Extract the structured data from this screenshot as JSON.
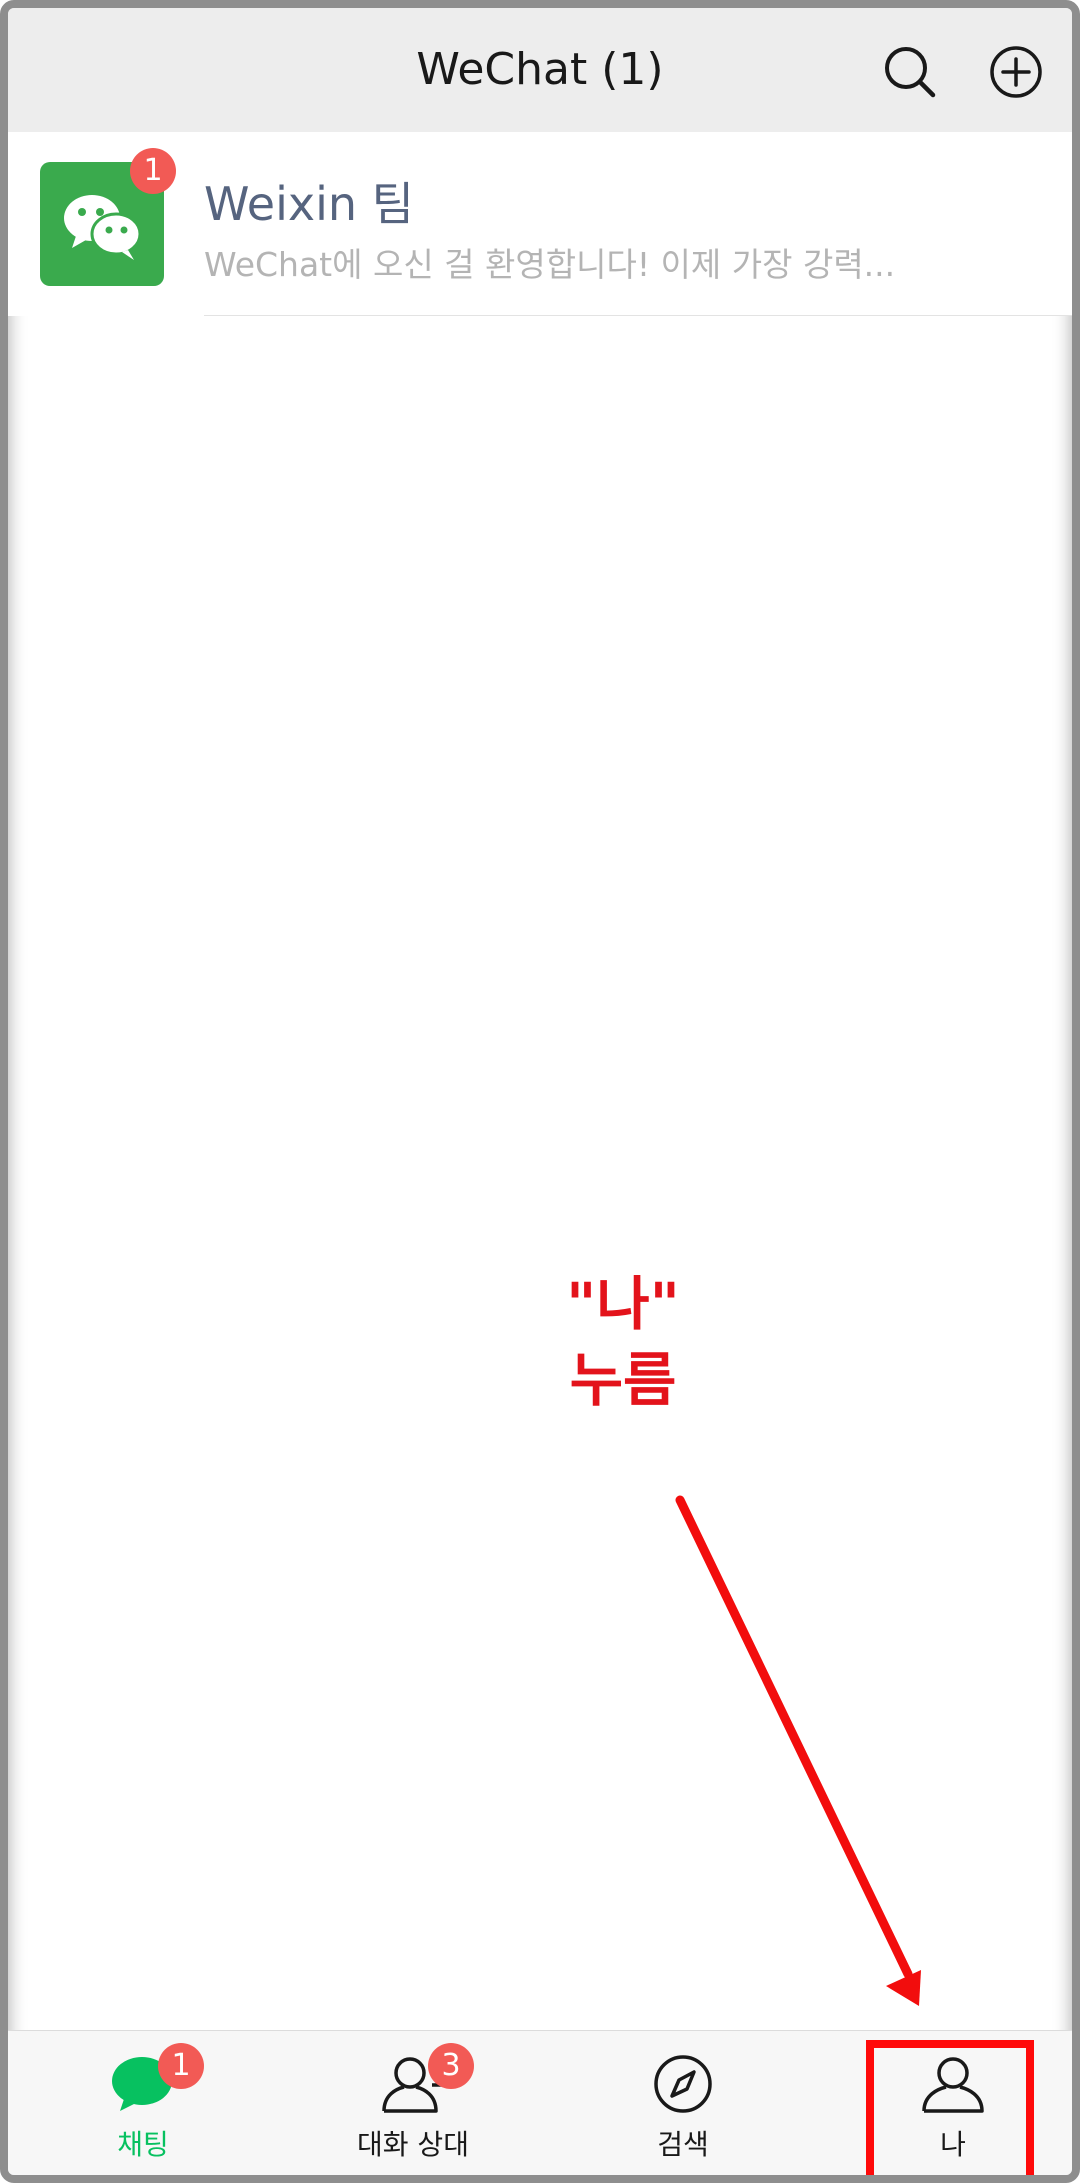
{
  "header": {
    "title": "WeChat (1)",
    "search_icon": "search-icon",
    "add_icon": "plus-circle-icon"
  },
  "chats": [
    {
      "name": "Weixin 팀",
      "preview": "WeChat에 오신 걸 환영합니다! 이제 가장 강력...",
      "unread": "1",
      "avatar_icon": "wechat-logo-icon"
    }
  ],
  "annotation": {
    "line1": "\"나\"",
    "line2": "누름"
  },
  "tabs": [
    {
      "label": "채팅",
      "icon": "chat-bubble-icon",
      "badge": "1",
      "active": true
    },
    {
      "label": "대화 상대",
      "icon": "contacts-icon",
      "badge": "3",
      "active": false
    },
    {
      "label": "검색",
      "icon": "compass-icon",
      "active": false
    },
    {
      "label": "나",
      "icon": "person-icon",
      "active": false
    }
  ],
  "colors": {
    "accent": "#07c160",
    "badge": "#f25a55",
    "annotation": "#e3131b",
    "avatar_bg": "#3aaa4d"
  }
}
